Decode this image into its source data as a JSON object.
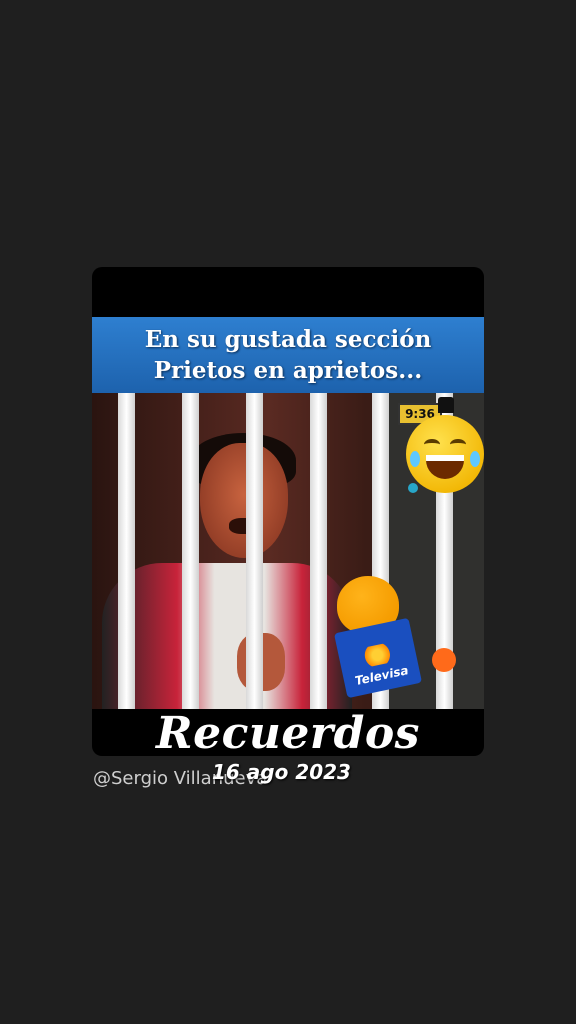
{
  "video": {
    "banner_line1": "En su gustada sección",
    "banner_line2": "Prietos en aprietos...",
    "clock_text": "9:36",
    "mic_brand": "Televisa",
    "title": "Recuerdos"
  },
  "caption": {
    "author": "@Sergio Villanueva",
    "date": "16 ago 2023"
  },
  "icons": [
    "laughing-emoji-icon",
    "microphone-icon"
  ],
  "colors": {
    "background": "#1f1f1f",
    "banner_blue": "#1d62ad",
    "mic_orange": "#f59c00",
    "mic_blue": "#1a4fbf"
  }
}
